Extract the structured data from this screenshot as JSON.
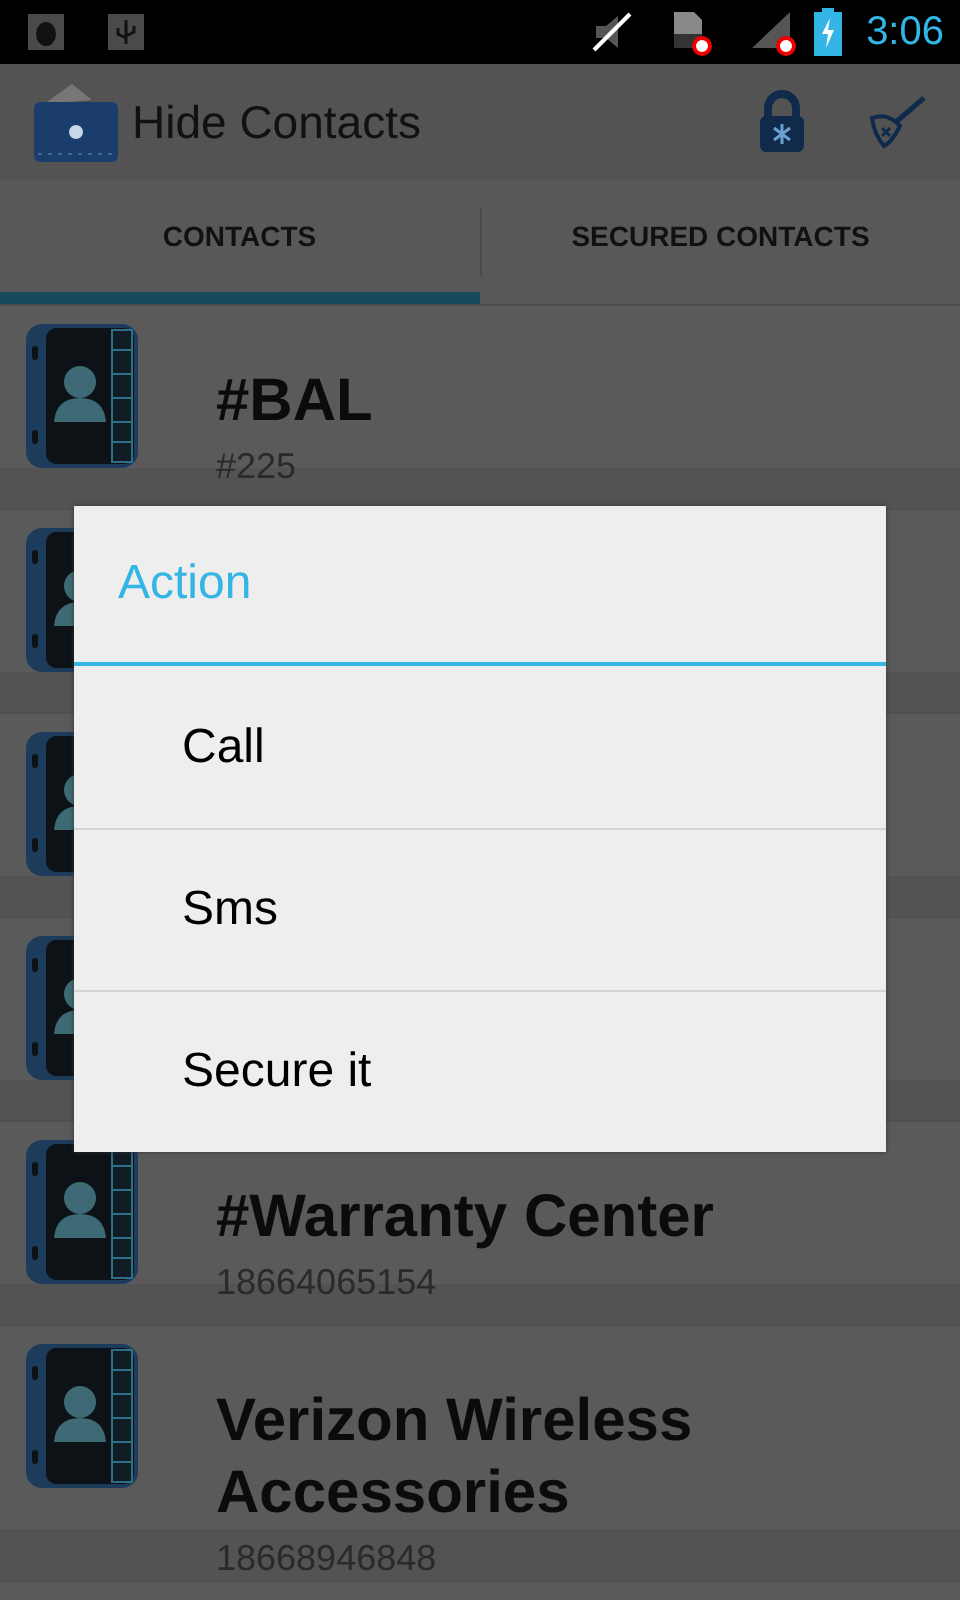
{
  "status_bar": {
    "time": "3:06"
  },
  "app_bar": {
    "title": "Hide Contacts"
  },
  "tabs": [
    {
      "label": "CONTACTS",
      "selected": true
    },
    {
      "label": "SECURED CONTACTS",
      "selected": false
    }
  ],
  "contacts": [
    {
      "kind": "contact",
      "name": "#BAL",
      "number": "#225"
    },
    {
      "kind": "covered"
    },
    {
      "kind": "covered"
    },
    {
      "kind": "covered"
    },
    {
      "kind": "contact",
      "name": "#Warranty Center",
      "number": "18664065154"
    },
    {
      "kind": "contact",
      "name": "Verizon Wireless Accessories",
      "number": "18668946848"
    }
  ],
  "dialog": {
    "title": "Action",
    "items": [
      "Call",
      "Sms",
      "Secure it"
    ]
  }
}
